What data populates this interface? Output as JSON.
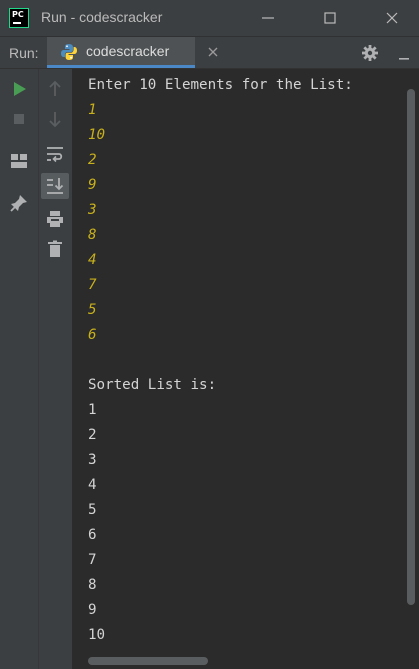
{
  "window": {
    "logo_text": "PC",
    "title": "Run - codescracker"
  },
  "run_panel": {
    "label": "Run:",
    "tab_label": "codescracker"
  },
  "console": {
    "prompt": "Enter 10 Elements for the List:",
    "inputs": [
      "1",
      "10",
      "2",
      "9",
      "3",
      "8",
      "4",
      "7",
      "5",
      "6"
    ],
    "result_header": "Sorted List is:",
    "outputs": [
      "1",
      "2",
      "3",
      "4",
      "5",
      "6",
      "7",
      "8",
      "9",
      "10"
    ]
  },
  "colors": {
    "input_text": "#c8b01c",
    "output_text": "#d4d4d4",
    "run_green": "#499c54",
    "accent_blue": "#4a88c7"
  },
  "icons": {
    "left_toolbar": [
      "run-icon",
      "stop-icon",
      "layout-icon",
      "pin-icon"
    ],
    "right_toolbar": [
      "up-arrow-icon",
      "down-arrow-icon",
      "soft-wrap-icon",
      "scroll-to-end-icon",
      "print-icon",
      "trash-icon"
    ]
  }
}
